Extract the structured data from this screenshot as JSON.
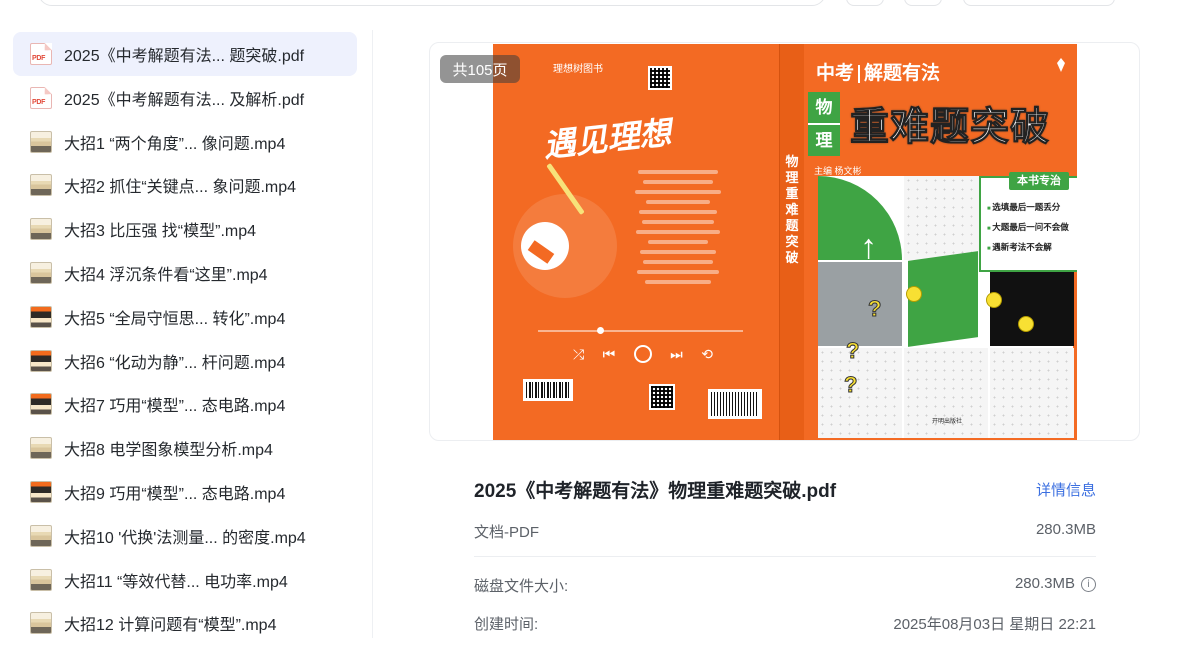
{
  "files": [
    {
      "name": "2025《中考解题有法... 题突破.pdf",
      "type": "pdf",
      "selected": true
    },
    {
      "name": "2025《中考解题有法... 及解析.pdf",
      "type": "pdf"
    },
    {
      "name": "大招1 “两个角度”... 像问题.mp4",
      "type": "mp4"
    },
    {
      "name": "大招2 抓住“关键点... 象问题.mp4",
      "type": "mp4"
    },
    {
      "name": "大招3 比压强 找“模型”.mp4",
      "type": "mp4"
    },
    {
      "name": "大招4 浮沉条件看“这里”.mp4",
      "type": "mp4"
    },
    {
      "name": "大招5 “全局守恒思... 转化”.mp4",
      "type": "mp4"
    },
    {
      "name": "大招6 “化动为静”... 杆问题.mp4",
      "type": "mp4"
    },
    {
      "name": "大招7 巧用“模型”... 态电路.mp4",
      "type": "mp4"
    },
    {
      "name": "大招8 电学图象模型分析.mp4",
      "type": "mp4"
    },
    {
      "name": "大招9 巧用“模型”... 态电路.mp4",
      "type": "mp4"
    },
    {
      "name": "大招10 '代换'法测量... 的密度.mp4",
      "type": "mp4"
    },
    {
      "name": "大招11 “等效代替... 电功率.mp4",
      "type": "mp4"
    },
    {
      "name": "大招12 计算问题有“模型”.mp4",
      "type": "mp4"
    }
  ],
  "preview": {
    "page_count": "共105页",
    "cover": {
      "publisher_mark": "理想树图书",
      "back_title": "遇见理想",
      "series": "中考",
      "series2": "解题有法",
      "subject_1": "物",
      "subject_2": "理",
      "main_title": "重难题突破",
      "editor": "主编 杨文彬",
      "spine_text": "物理 重难题突破",
      "badge_title": "本书专治",
      "badge_lines": [
        "选填最后一题丢分",
        "大题最后一问不会做",
        "遇新考法不会解"
      ],
      "press": "开明出版社"
    }
  },
  "detail": {
    "title": "2025《中考解题有法》物理重难题突破.pdf",
    "link": "详情信息",
    "type_label": "文档-PDF",
    "type_size": "280.3MB",
    "rows": [
      {
        "label": "磁盘文件大小:",
        "value": "280.3MB"
      },
      {
        "label": "创建时间:",
        "value": "2025年08月03日 星期日 22:21"
      }
    ]
  },
  "colors": {
    "selected_bg": "#eef1fd",
    "link": "#3b6fe0",
    "cover_orange": "#f36a23",
    "cover_green": "#3fa444"
  }
}
